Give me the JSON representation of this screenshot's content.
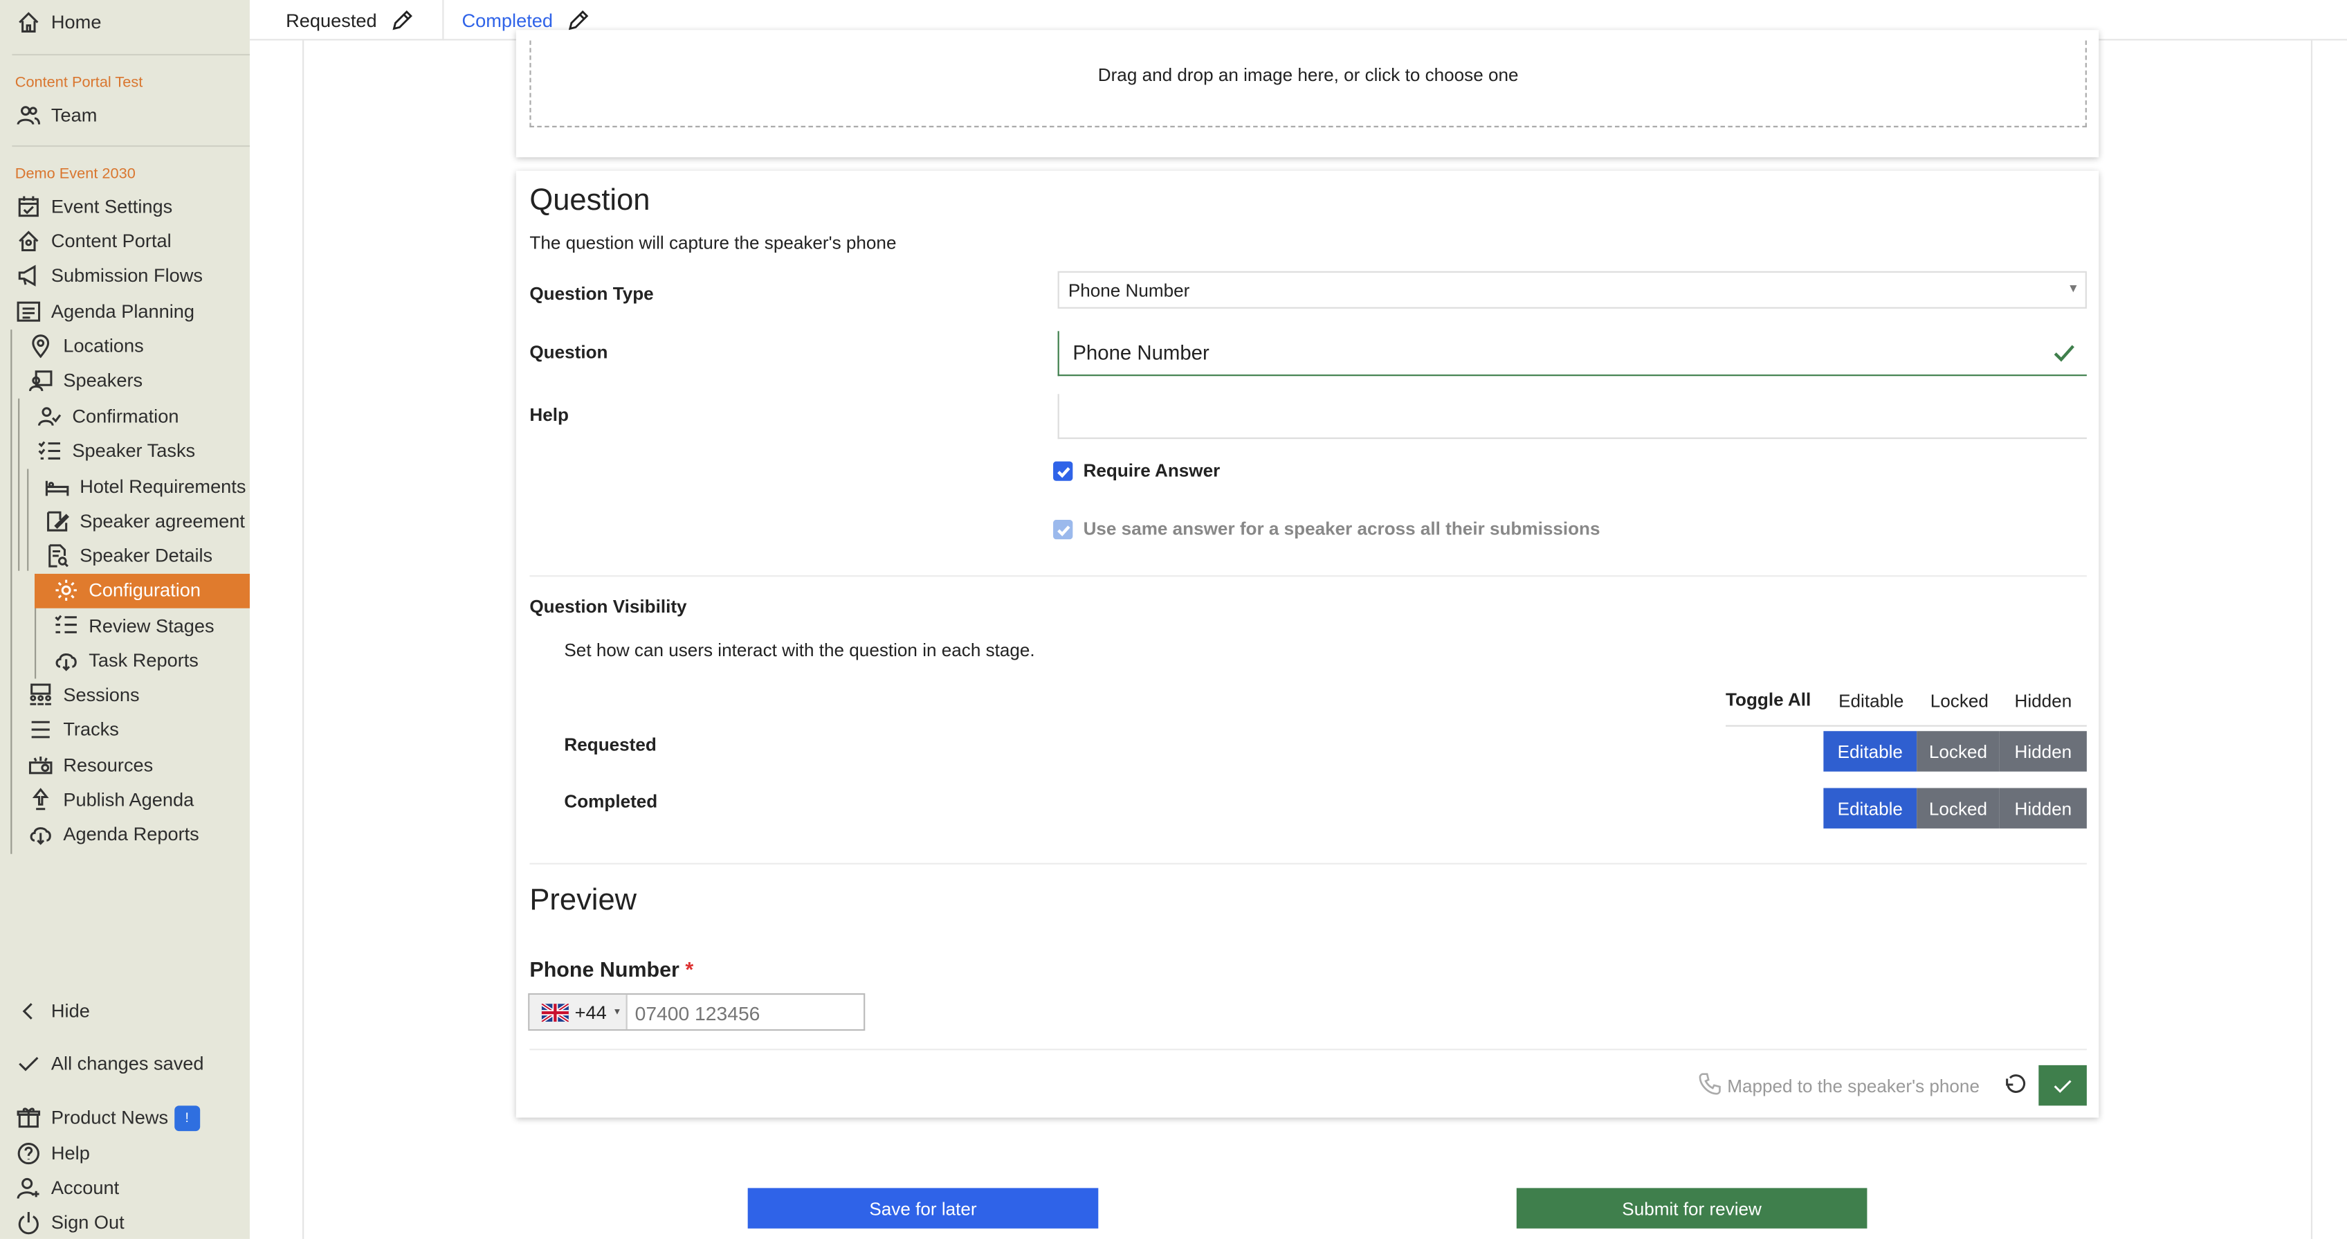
{
  "sidebar": {
    "home": "Home",
    "section1": "Content Portal Test",
    "team": "Team",
    "section2": "Demo Event 2030",
    "items": [
      "Event Settings",
      "Content Portal",
      "Submission Flows",
      "Agenda Planning",
      "Locations",
      "Speakers",
      "Confirmation",
      "Speaker Tasks",
      "Hotel Requirements",
      "Speaker agreement",
      "Speaker Details",
      "Configuration",
      "Review Stages",
      "Task Reports",
      "Sessions",
      "Tracks",
      "Resources",
      "Publish Agenda",
      "Agenda Reports"
    ],
    "hide": "Hide",
    "saved": "All changes saved",
    "news": "Product News",
    "news_badge": "!",
    "help": "Help",
    "account": "Account",
    "signout": "Sign Out"
  },
  "tabs": {
    "requested": "Requested",
    "completed": "Completed"
  },
  "upload": {
    "text": "Drag and drop an image here, or click to choose one"
  },
  "question": {
    "title": "Question",
    "description": "The question will capture the speaker's phone",
    "type_label": "Question Type",
    "type_value": "Phone Number",
    "question_label": "Question",
    "question_value": "Phone Number",
    "help_label": "Help",
    "help_value": "",
    "require_answer": "Require Answer",
    "require_checked": true,
    "same_answer": "Use same answer for a speaker across all their submissions",
    "same_checked": true
  },
  "visibility": {
    "title": "Question Visibility",
    "description": "Set how can users interact with the question in each stage.",
    "toggle_all": "Toggle All",
    "header_options": [
      "Editable",
      "Locked",
      "Hidden"
    ],
    "stages": [
      {
        "name": "Requested",
        "options": [
          "Editable",
          "Locked",
          "Hidden"
        ],
        "selected": "Editable"
      },
      {
        "name": "Completed",
        "options": [
          "Editable",
          "Locked",
          "Hidden"
        ],
        "selected": "Editable"
      }
    ]
  },
  "preview": {
    "title": "Preview",
    "field_label": "Phone Number",
    "required_mark": "*",
    "country_code": "+44",
    "phone_placeholder": "07400 123456",
    "mapping": "Mapped to the speaker's phone"
  },
  "actions": {
    "save": "Save for later",
    "submit": "Submit for review"
  },
  "colors": {
    "accent": "#e07b2d",
    "primary": "#2f63e8",
    "segment_selected": "#2f5fd0",
    "segment": "#6b7079",
    "success": "#3f7f4c",
    "check": "#2f6fe0"
  }
}
